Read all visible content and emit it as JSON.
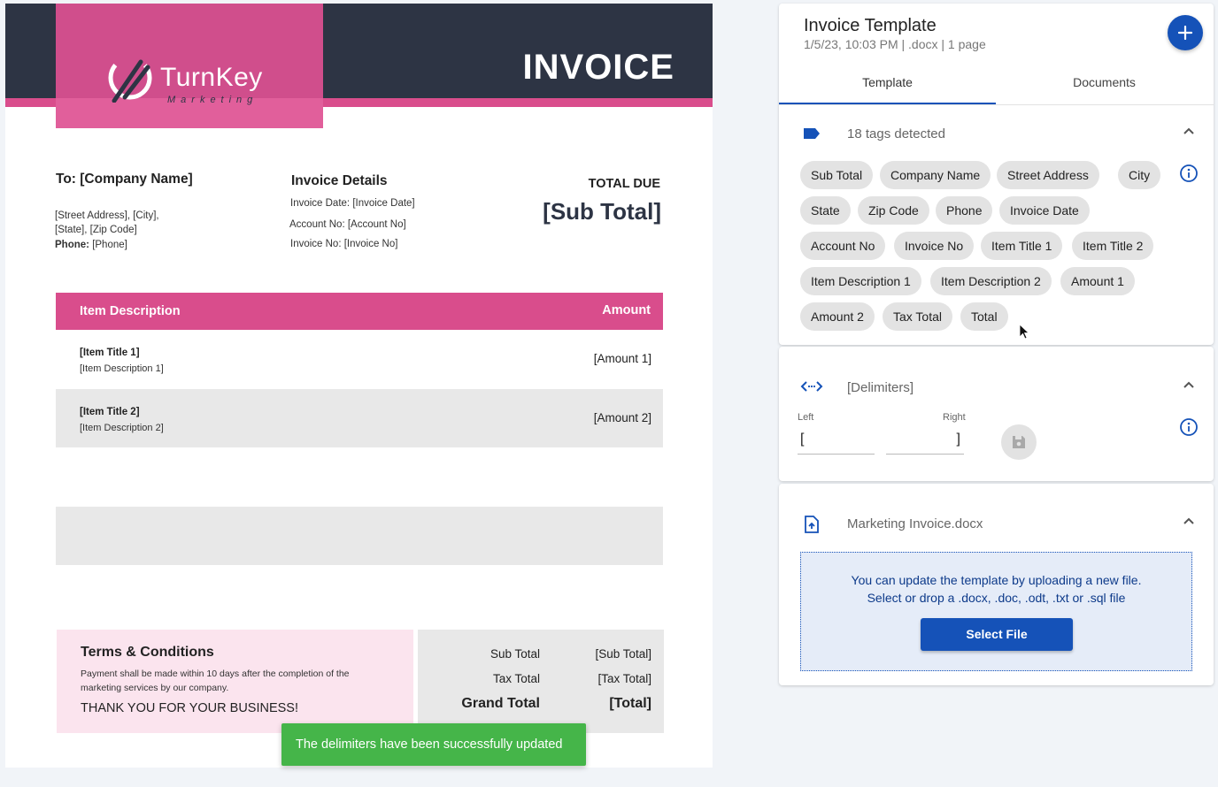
{
  "document": {
    "logo": {
      "name": "TurnKey",
      "tagline": "Marketing"
    },
    "heading": "INVOICE",
    "to_label": "To: [Company Name]",
    "address_line1": "[Street Address], [City],",
    "address_line2": "[State], [Zip Code]",
    "phone_label": "Phone:",
    "phone_value": "[Phone]",
    "details_title": "Invoice Details",
    "invoice_date": "Invoice Date: [Invoice Date]",
    "account_no": "Account No: [Account No]",
    "invoice_no": "Invoice No: [Invoice No]",
    "total_due_label": "TOTAL DUE",
    "total_due_value": "[Sub Total]",
    "table": {
      "col_description": "Item Description",
      "col_amount": "Amount",
      "rows": [
        {
          "title": "[Item Title 1]",
          "description": "[Item Description 1]",
          "amount": "[Amount 1]"
        },
        {
          "title": "[Item Title 2]",
          "description": "[Item Description 2]",
          "amount": "[Amount 2]"
        }
      ]
    },
    "terms": {
      "title": "Terms & Conditions",
      "body": "Payment shall be made within 10 days after the completion of the marketing services by our company.",
      "thanks": "THANK YOU FOR YOUR BUSINESS!"
    },
    "totals": {
      "sub_total_label": "Sub Total",
      "sub_total_value": "[Sub Total]",
      "tax_total_label": "Tax Total",
      "tax_total_value": "[Tax Total]",
      "grand_total_label": "Grand Total",
      "grand_total_value": "[Total]"
    }
  },
  "toast": "The delimiters have been successfully updated",
  "panel": {
    "title": "Invoice Template",
    "meta": "1/5/23, 10:03 PM | .docx | 1 page",
    "add_icon": "plus-icon",
    "tabs": [
      {
        "label": "Template",
        "active": true
      },
      {
        "label": "Documents",
        "active": false
      }
    ],
    "tags": {
      "heading": "18 tags detected",
      "items": [
        "Sub Total",
        "Company Name",
        "Street Address",
        "City",
        "State",
        "Zip Code",
        "Phone",
        "Invoice Date",
        "Account No",
        "Invoice No",
        "Item Title 1",
        "Item Title 2",
        "Item Description 1",
        "Item Description 2",
        "Amount 1",
        "Amount 2",
        "Tax Total",
        "Total"
      ]
    },
    "delimiters": {
      "heading": "[Delimiters]",
      "left_label": "Left",
      "left_value": "[",
      "right_label": "Right",
      "right_value": "]"
    },
    "file": {
      "heading": "Marketing Invoice.docx",
      "upload_line1": "You can update the template by uploading a new file.",
      "upload_line2": "Select or drop a .docx, .doc, .odt, .txt or .sql file",
      "button": "Select File"
    },
    "colors": {
      "accent": "#1552b8",
      "tag_bg": "#e3e3e3",
      "invoice_pink": "#d94d8c",
      "invoice_navy": "#2d3444",
      "toast_green": "#45b549"
    }
  }
}
